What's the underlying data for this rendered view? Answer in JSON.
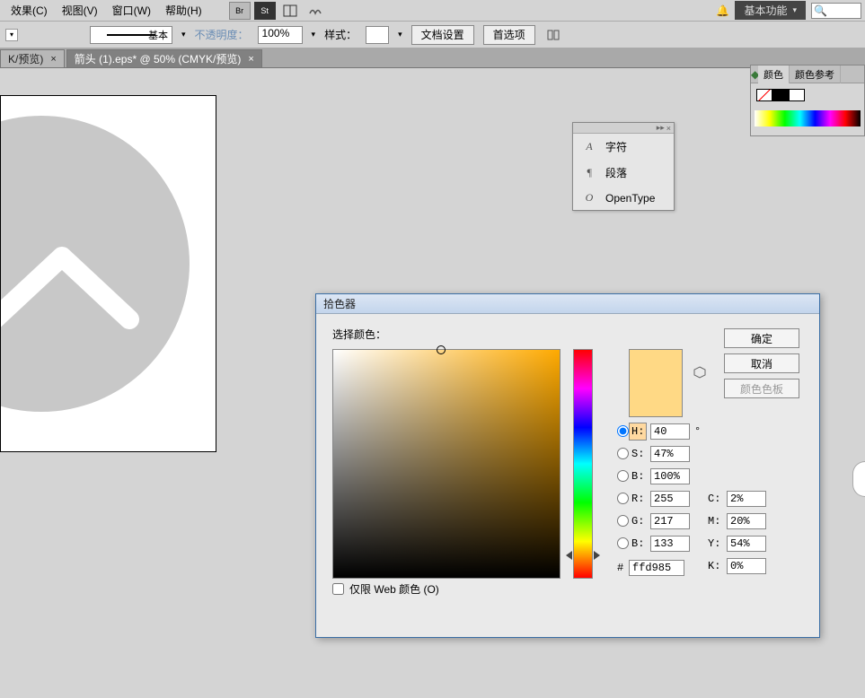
{
  "menu": {
    "effect": "效果(C)",
    "view": "视图(V)",
    "window": "窗口(W)",
    "help": "帮助(H)",
    "workspace": "基本功能"
  },
  "options": {
    "stroke_style": "基本",
    "opacity_label": "不透明度：",
    "opacity_value": "100%",
    "style_label": "样式：",
    "doc_setup": "文档设置",
    "prefs": "首选项"
  },
  "tabs": {
    "t1": "K/预览)",
    "t2": "箭头 (1).eps* @ 50% (CMYK/预览)"
  },
  "char_panel": {
    "char": "字符",
    "para": "段落",
    "ot": "OpenType"
  },
  "color_panel": {
    "tab1": "颜色",
    "tab2": "颜色参考"
  },
  "picker": {
    "title": "拾色器",
    "select": "选择颜色：",
    "ok": "确定",
    "cancel": "取消",
    "swatches": "颜色色板",
    "H_lab": "H:",
    "H_val": "40",
    "H_unit": "°",
    "S_lab": "S:",
    "S_val": "47%",
    "Bv_lab": "B:",
    "Bv_val": "100%",
    "R_lab": "R:",
    "R_val": "255",
    "G_lab": "G:",
    "G_val": "217",
    "B_lab": "B:",
    "B_val": "133",
    "hex_prefix": "#",
    "hex": "ffd985",
    "C_lab": "C:",
    "C_val": "2%",
    "M_lab": "M:",
    "M_val": "20%",
    "Y_lab": "Y:",
    "Y_val": "54%",
    "K_lab": "K:",
    "K_val": "0%",
    "webonly": "仅限 Web 颜色 (O)"
  }
}
